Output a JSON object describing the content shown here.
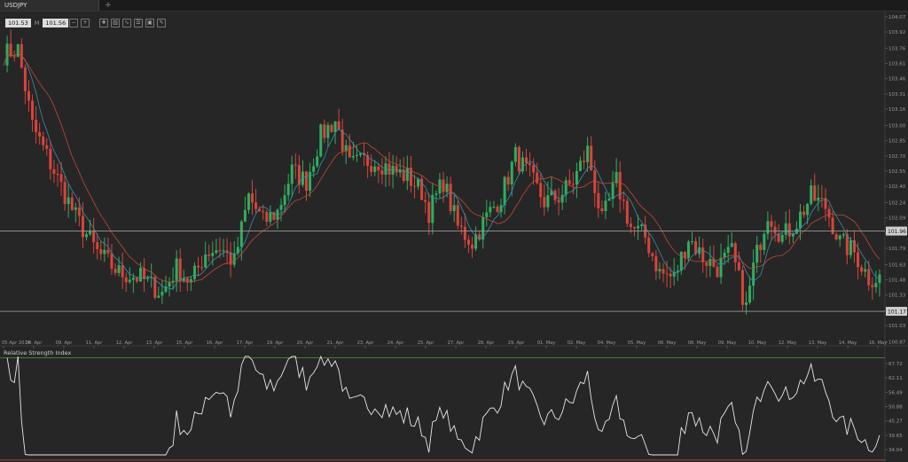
{
  "tab": {
    "symbol": "USDJPY",
    "add_label": "+"
  },
  "quote": {
    "bid": "101.53",
    "separator": "M",
    "ask": "101.56"
  },
  "toolbar_icons": [
    "zoom-out-icon",
    "zoom-in-icon",
    "crosshair-icon",
    "chart-type-icon",
    "indicators-icon",
    "templates-icon",
    "save-icon",
    "draw-icon"
  ],
  "colors": {
    "background": "#262626",
    "bull": "#2fae5f",
    "bear": "#d8443a",
    "ma_fast": "#3a8fa8",
    "ma_slow": "#c04a3a",
    "rsi_line": "#e6e6e6",
    "rsi_upper": "#4a7a3a",
    "rsi_lower": "#b03a3a"
  },
  "chart_data": [
    {
      "type": "candlestick",
      "symbol": "USDJPY",
      "y_ticks": [
        "104.07",
        "103.92",
        "103.76",
        "103.61",
        "103.46",
        "103.31",
        "103.16",
        "103.00",
        "102.85",
        "102.70",
        "102.55",
        "102.40",
        "102.24",
        "102.09",
        "101.94",
        "101.79",
        "101.63",
        "101.48",
        "101.33",
        "101.18",
        "101.03",
        "100.87"
      ],
      "ylim": [
        100.83,
        104.13
      ],
      "x_labels": [
        "05 Apr 2014",
        "08. Apr",
        "09. Apr",
        "11. Apr",
        "12. Apr",
        "13. Apr",
        "15. Apr",
        "16. Apr",
        "17. Apr",
        "19. Apr",
        "20. Apr",
        "21. Apr",
        "23. Apr",
        "24. Apr",
        "25. Apr",
        "27. Apr",
        "28. Apr",
        "29. Apr",
        "01. May",
        "02. May",
        "04. May",
        "05. May",
        "06. May",
        "08. May",
        "09. May",
        "10. May",
        "12. May",
        "13. May",
        "14. May",
        "16. May"
      ],
      "price_lines": [
        {
          "label": "101.96",
          "value": 101.96
        },
        {
          "label": "101.17",
          "value": 101.17
        }
      ],
      "moving_averages": [
        "fast",
        "slow"
      ],
      "anchors": [
        [
          0,
          103.7
        ],
        [
          4,
          103.75
        ],
        [
          8,
          103.0
        ],
        [
          14,
          102.55
        ],
        [
          20,
          102.1
        ],
        [
          26,
          101.75
        ],
        [
          32,
          101.55
        ],
        [
          38,
          101.5
        ],
        [
          44,
          101.35
        ],
        [
          48,
          101.6
        ],
        [
          52,
          101.45
        ],
        [
          56,
          101.75
        ],
        [
          60,
          101.8
        ],
        [
          64,
          101.65
        ],
        [
          68,
          102.3
        ],
        [
          72,
          102.05
        ],
        [
          76,
          102.15
        ],
        [
          80,
          102.55
        ],
        [
          84,
          102.45
        ],
        [
          88,
          102.9
        ],
        [
          92,
          103.05
        ],
        [
          96,
          102.6
        ],
        [
          100,
          102.65
        ],
        [
          104,
          102.65
        ],
        [
          108,
          102.55
        ],
        [
          112,
          102.5
        ],
        [
          116,
          102.35
        ],
        [
          118,
          102.15
        ],
        [
          122,
          102.45
        ],
        [
          126,
          102.0
        ],
        [
          130,
          101.85
        ],
        [
          134,
          102.1
        ],
        [
          138,
          102.3
        ],
        [
          142,
          102.7
        ],
        [
          146,
          102.5
        ],
        [
          150,
          102.25
        ],
        [
          154,
          102.3
        ],
        [
          158,
          102.45
        ],
        [
          162,
          102.75
        ],
        [
          166,
          102.05
        ],
        [
          170,
          102.45
        ],
        [
          174,
          102.0
        ],
        [
          178,
          101.9
        ],
        [
          182,
          101.55
        ],
        [
          186,
          101.5
        ],
        [
          190,
          101.9
        ],
        [
          194,
          101.7
        ],
        [
          198,
          101.6
        ],
        [
          202,
          101.75
        ],
        [
          206,
          101.2
        ],
        [
          208,
          101.6
        ],
        [
          212,
          102.15
        ],
        [
          216,
          101.9
        ],
        [
          220,
          102.05
        ],
        [
          224,
          102.3
        ],
        [
          228,
          102.2
        ],
        [
          232,
          101.85
        ],
        [
          236,
          101.75
        ],
        [
          240,
          101.5
        ],
        [
          243,
          101.5
        ]
      ],
      "rsi": {
        "title": "Relative Strength Index",
        "y_ticks": [
          "67.72",
          "62.11",
          "56.49",
          "50.88",
          "45.27",
          "39.65",
          "34.04"
        ],
        "ylim": [
          32.0,
          70.5
        ],
        "levels": [
          70,
          30
        ]
      }
    }
  ]
}
